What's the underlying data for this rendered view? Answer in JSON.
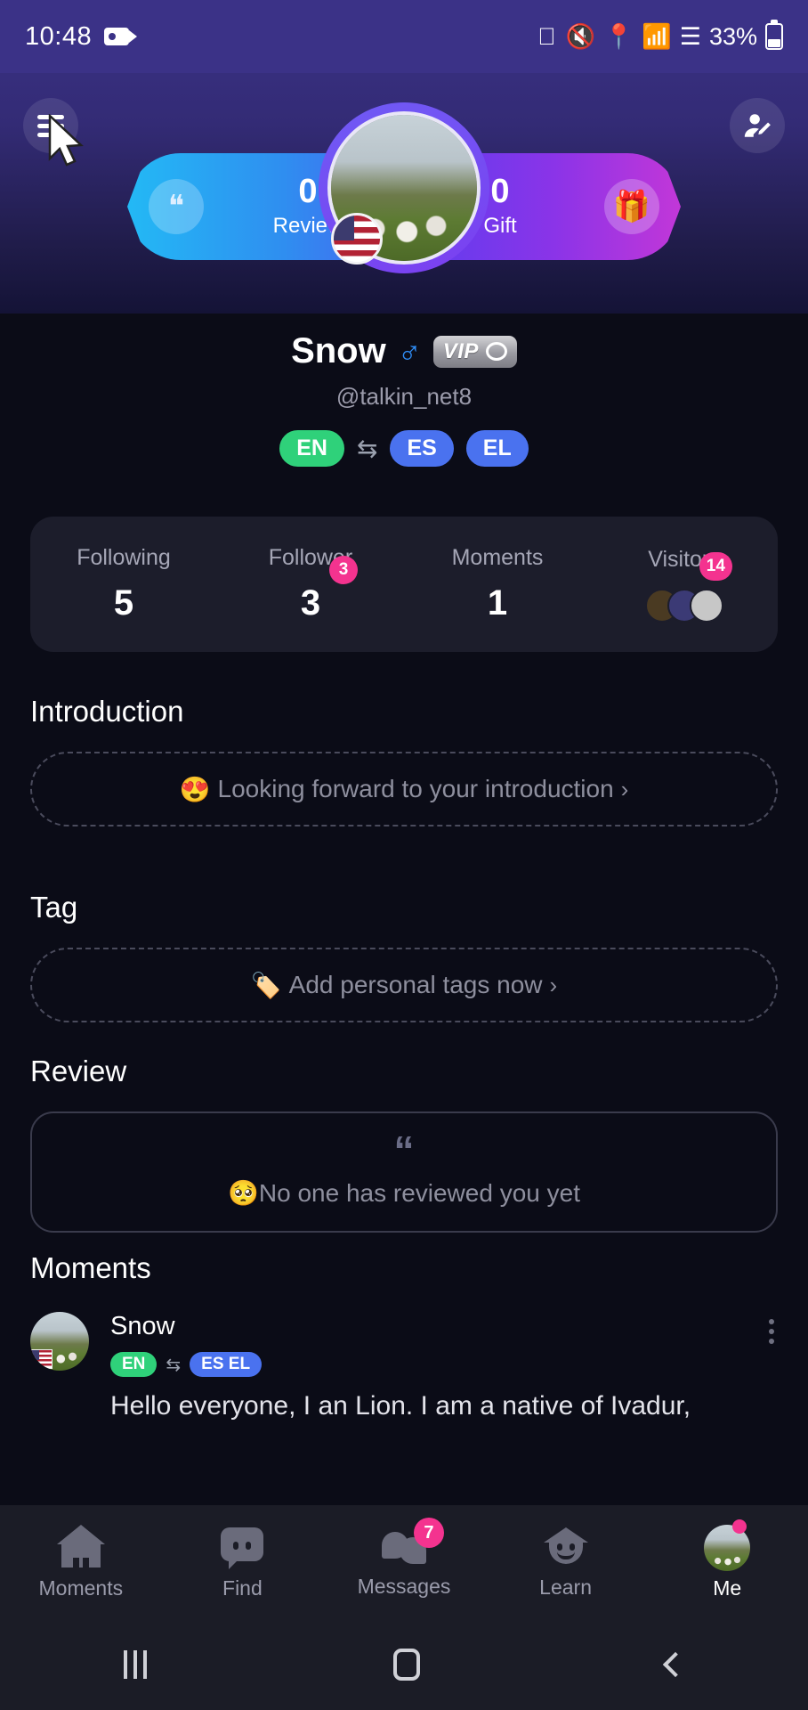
{
  "status_bar": {
    "time": "10:48",
    "battery_text": "33%",
    "icons": [
      "video-record-icon",
      "bluetooth-icon",
      "mute-icon",
      "location-icon",
      "wifi-icon",
      "cellular-signal-icon",
      "battery-icon"
    ]
  },
  "header": {
    "menu_icon": "hamburger-menu-icon",
    "edit_profile_icon": "edit-profile-icon",
    "review": {
      "count": "0",
      "label": "Review",
      "icon": "quote-icon"
    },
    "gift": {
      "count": "0",
      "label": "Gift",
      "icon": "gift-icon"
    },
    "avatar_flag": "us-flag-icon"
  },
  "profile": {
    "name": "Snow",
    "gender_symbol": "♂",
    "vip_label": "VIP",
    "handle": "@talkin_net8",
    "native_lang": "EN",
    "swap_icon": "swap-icon",
    "learning_langs": [
      "ES",
      "EL"
    ]
  },
  "stats": [
    {
      "label": "Following",
      "value": "5",
      "badge": ""
    },
    {
      "label": "Follower",
      "value": "3",
      "badge": "3"
    },
    {
      "label": "Moments",
      "value": "1",
      "badge": ""
    },
    {
      "label": "Visitors",
      "value": "",
      "badge": "14"
    }
  ],
  "introduction": {
    "title": "Introduction",
    "placeholder_emoji": "😍",
    "placeholder": "Looking forward to your introduction",
    "chevron": "›"
  },
  "tag": {
    "title": "Tag",
    "placeholder_emoji": "🏷️",
    "placeholder": "Add personal tags now",
    "chevron": "›"
  },
  "review": {
    "title": "Review",
    "quote_icon": "“",
    "empty_emoji": "🥺",
    "empty_text": "No one has reviewed you yet"
  },
  "moments": {
    "title": "Moments",
    "post": {
      "author": "Snow",
      "native_lang": "EN",
      "learning_langs": "ES  EL",
      "text": "Hello everyone, I an Lion. I am a native of Ivadur,",
      "more_icon": "more-options-icon",
      "flag": "us-flag-icon"
    }
  },
  "tabbar": {
    "items": [
      {
        "label": "Moments",
        "icon": "home-icon",
        "badge": "",
        "active": false
      },
      {
        "label": "Find",
        "icon": "chat-bubble-icon",
        "badge": "",
        "active": false
      },
      {
        "label": "Messages",
        "icon": "messages-icon",
        "badge": "7",
        "active": false
      },
      {
        "label": "Learn",
        "icon": "graduation-cap-icon",
        "badge": "",
        "active": false
      },
      {
        "label": "Me",
        "icon": "avatar-icon",
        "badge": "dot",
        "active": true
      }
    ]
  },
  "android_nav": {
    "recents": "recents-icon",
    "home": "home-button-icon",
    "back": "back-button-icon"
  },
  "colors": {
    "accent_pink": "#f4338f",
    "accent_green": "#2fd17a",
    "accent_blue": "#4a72ef",
    "background": "#0b0c17",
    "card": "#1c1d2b"
  }
}
